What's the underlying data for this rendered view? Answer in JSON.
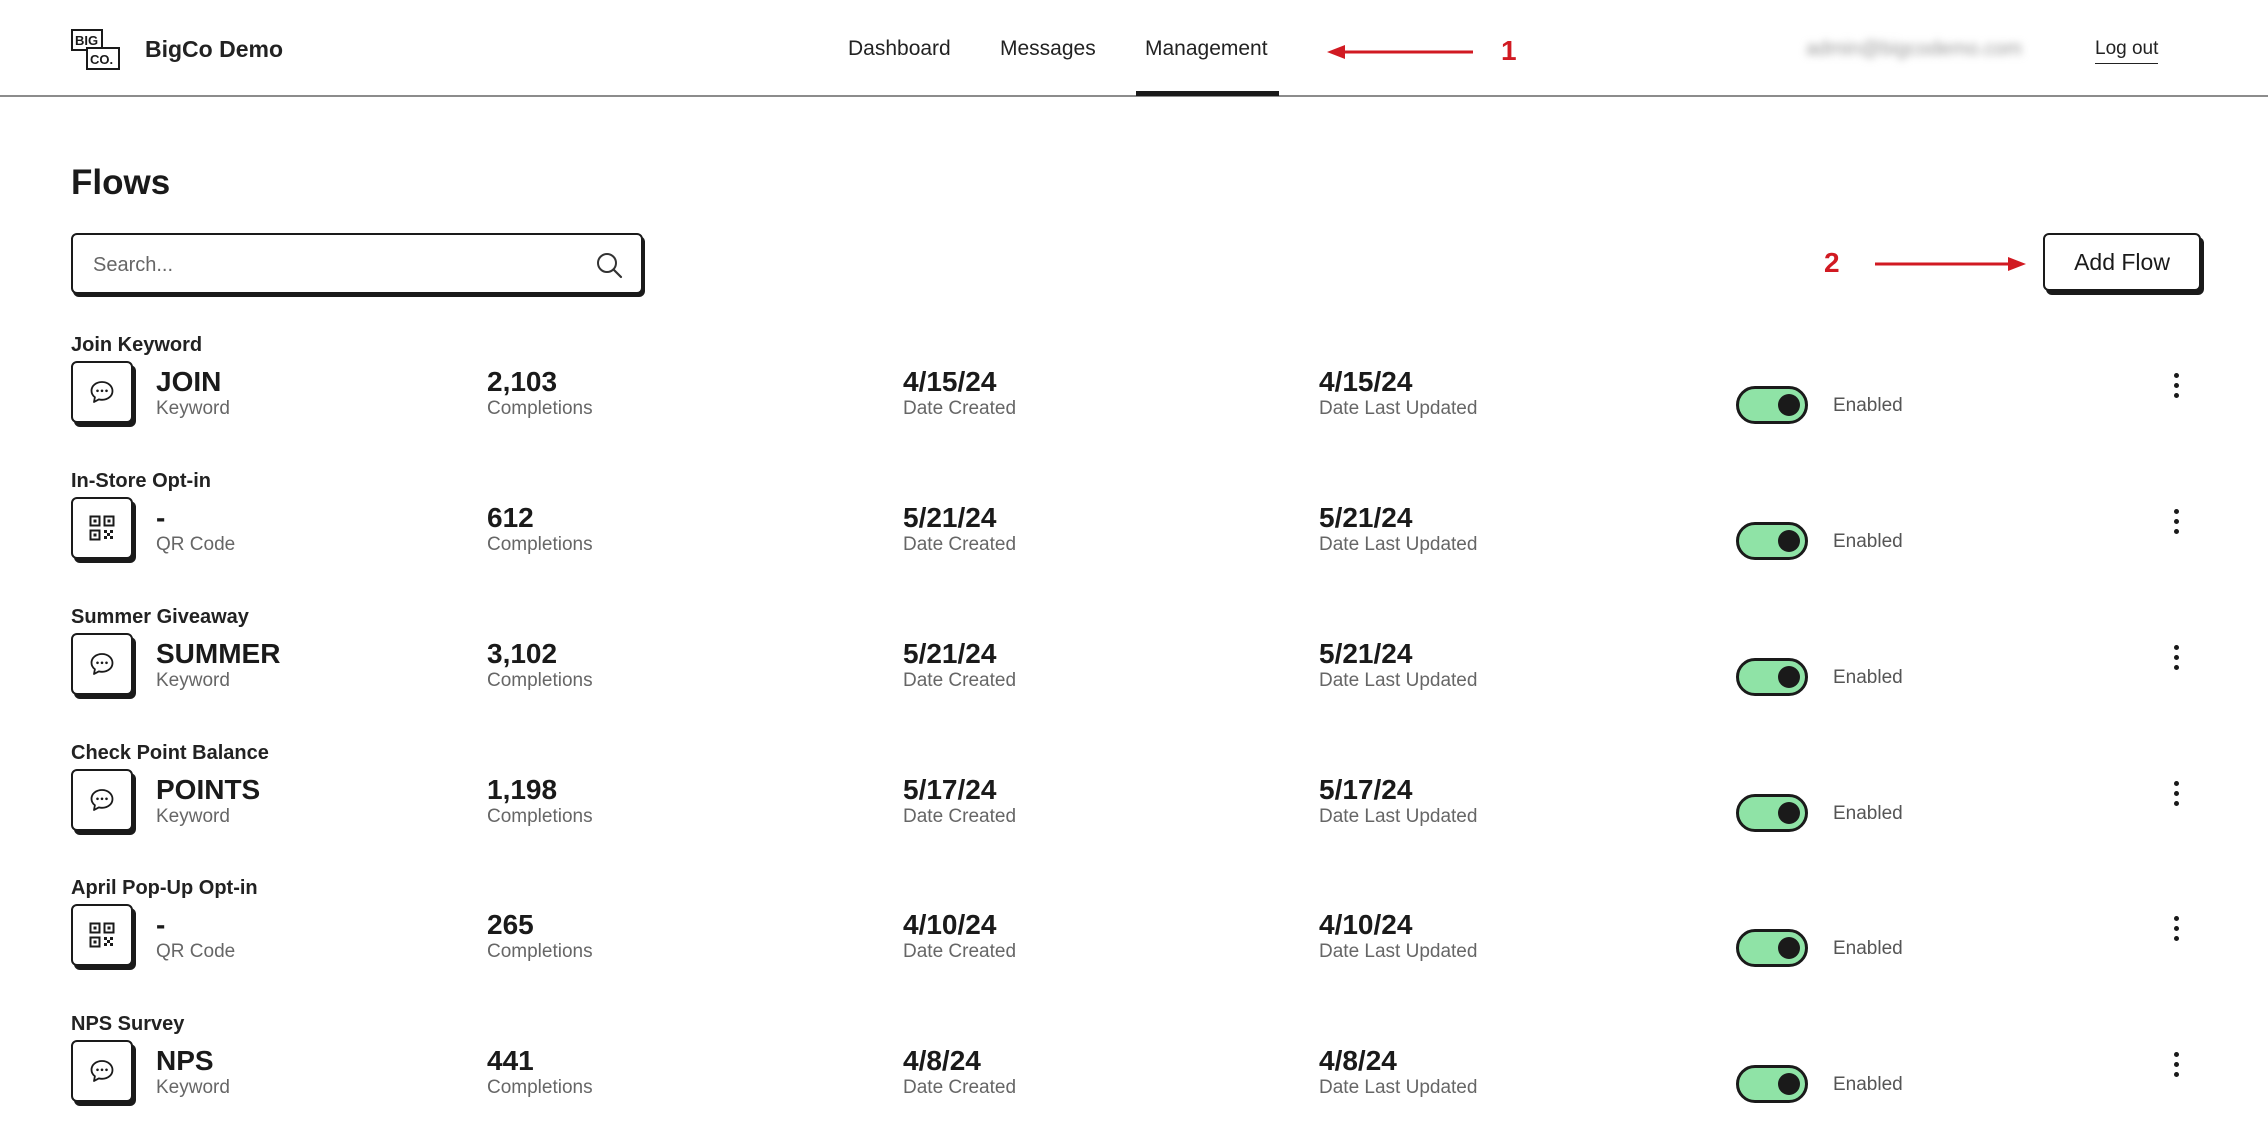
{
  "header": {
    "brand": "BigCo Demo",
    "logo_text_top": "BIG",
    "logo_text_bottom": "CO.",
    "nav": [
      {
        "label": "Dashboard",
        "active": false
      },
      {
        "label": "Messages",
        "active": false
      },
      {
        "label": "Management",
        "active": true
      }
    ],
    "email": "admin@bigcodemo.com",
    "logout_label": "Log out"
  },
  "annotations": [
    {
      "number": "1",
      "color": "#d11a22"
    },
    {
      "number": "2",
      "color": "#d11a22"
    }
  ],
  "page": {
    "title": "Flows",
    "search_placeholder": "Search...",
    "add_button_label": "Add Flow"
  },
  "labels": {
    "completions": "Completions",
    "date_created": "Date Created",
    "date_updated": "Date Last Updated"
  },
  "accent_colors": {
    "toggle_on": "#8fe3a6",
    "ink": "#1a1a1a",
    "annotation": "#d11a22"
  },
  "flows": [
    {
      "title": "Join Keyword",
      "icon": "chat-bubble-icon",
      "trigger": "JOIN",
      "trigger_type": "Keyword",
      "completions": "2,103",
      "date_created": "4/15/24",
      "date_updated": "4/15/24",
      "status": "Enabled"
    },
    {
      "title": "In-Store Opt-in",
      "icon": "qr-code-icon",
      "trigger": "-",
      "trigger_type": "QR Code",
      "completions": "612",
      "date_created": "5/21/24",
      "date_updated": "5/21/24",
      "status": "Enabled"
    },
    {
      "title": "Summer Giveaway",
      "icon": "chat-bubble-icon",
      "trigger": "SUMMER",
      "trigger_type": "Keyword",
      "completions": "3,102",
      "date_created": "5/21/24",
      "date_updated": "5/21/24",
      "status": "Enabled"
    },
    {
      "title": "Check Point Balance",
      "icon": "chat-bubble-icon",
      "trigger": "POINTS",
      "trigger_type": "Keyword",
      "completions": "1,198",
      "date_created": "5/17/24",
      "date_updated": "5/17/24",
      "status": "Enabled"
    },
    {
      "title": "April Pop-Up Opt-in",
      "icon": "qr-code-icon",
      "trigger": "-",
      "trigger_type": "QR Code",
      "completions": "265",
      "date_created": "4/10/24",
      "date_updated": "4/10/24",
      "status": "Enabled"
    },
    {
      "title": "NPS Survey",
      "icon": "chat-bubble-icon",
      "trigger": "NPS",
      "trigger_type": "Keyword",
      "completions": "441",
      "date_created": "4/8/24",
      "date_updated": "4/8/24",
      "status": "Enabled"
    }
  ]
}
